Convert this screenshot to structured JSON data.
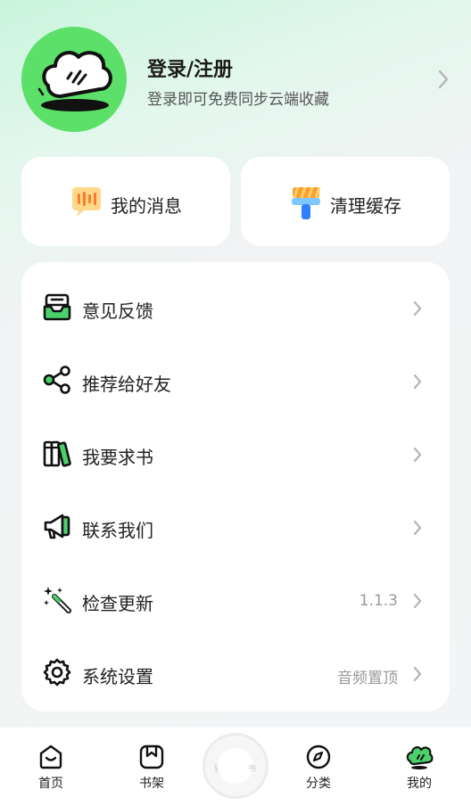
{
  "profile": {
    "title": "登录/注册",
    "subtitle": "登录即可免费同步云端收藏",
    "avatar_icon": "cloud-mascot-icon",
    "avatar_bg": "#5ce06a"
  },
  "quick_actions": [
    {
      "label": "我的消息",
      "icon": "message-icon"
    },
    {
      "label": "清理缓存",
      "icon": "brush-icon"
    }
  ],
  "menu": [
    {
      "label": "意见反馈",
      "icon": "feedback-icon",
      "value": ""
    },
    {
      "label": "推荐给好友",
      "icon": "share-icon",
      "value": ""
    },
    {
      "label": "我要求书",
      "icon": "books-icon",
      "value": ""
    },
    {
      "label": "联系我们",
      "icon": "megaphone-icon",
      "value": ""
    },
    {
      "label": "检查更新",
      "icon": "magic-wand-icon",
      "value": "1.1.3"
    },
    {
      "label": "系统设置",
      "icon": "gear-icon",
      "value": "音频置顶"
    }
  ],
  "bottom_nav": [
    {
      "label": "首页",
      "icon": "home-icon"
    },
    {
      "label": "书架",
      "icon": "bookshelf-icon"
    },
    {
      "label": "分类",
      "icon": "compass-icon"
    },
    {
      "label": "我的",
      "icon": "profile-cloud-icon"
    }
  ],
  "center_button": {
    "left_text": "轻",
    "right_text": "书"
  },
  "colors": {
    "accent": "#5ce06a",
    "chevron": "#b5b5b5"
  }
}
